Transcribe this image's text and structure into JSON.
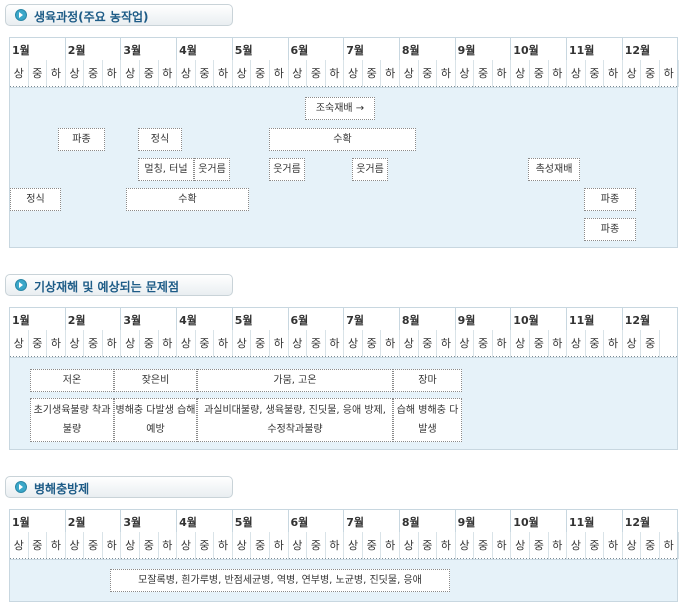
{
  "sections": [
    {
      "title": "생육과정(주요 농작업)",
      "months": [
        "1월",
        "2월",
        "3월",
        "4월",
        "5월",
        "6월",
        "7월",
        "8월",
        "9월",
        "10월",
        "11월",
        "12월"
      ],
      "periods": [
        "상",
        "중",
        "하"
      ],
      "boxes": [
        {
          "name": "box-nursery-transplant",
          "text": "조숙재배 →"
        },
        {
          "name": "box-sowing-1",
          "text": "파종"
        },
        {
          "name": "box-planting-1",
          "text": "정식"
        },
        {
          "name": "box-harvest-1",
          "text": "수확"
        },
        {
          "name": "box-mulch-tunnel",
          "text": "멀칭, 터널"
        },
        {
          "name": "box-topdress-1",
          "text": "웃거름"
        },
        {
          "name": "box-topdress-2",
          "text": "웃거름"
        },
        {
          "name": "box-topdress-3",
          "text": "웃거름"
        },
        {
          "name": "box-forcing-culture",
          "text": "촉성재배"
        },
        {
          "name": "box-planting-2",
          "text": "정식"
        },
        {
          "name": "box-harvest-2",
          "text": "수확"
        },
        {
          "name": "box-sowing-2",
          "text": "파종"
        },
        {
          "name": "box-sowing-3",
          "text": "파종"
        }
      ]
    },
    {
      "title": "기상재해 및 예상되는 문제점",
      "months": [
        "1월",
        "2월",
        "3월",
        "4월",
        "5월",
        "6월",
        "7월",
        "8월",
        "9월",
        "10월",
        "11월",
        "12월"
      ],
      "periods": [
        "상",
        "중",
        "하"
      ],
      "boxes": [
        {
          "name": "box-low-temp",
          "text": "저온"
        },
        {
          "name": "box-frequent-rain",
          "text": "잦은비"
        },
        {
          "name": "box-drought-heat",
          "text": "가뭄, 고온"
        },
        {
          "name": "box-monsoon",
          "text": "장마"
        },
        {
          "name": "box-early-growth",
          "text": "초기생육불량 착과불량"
        },
        {
          "name": "box-pest-humidity",
          "text": "병해충 다발생 습해예방"
        },
        {
          "name": "box-overgrowth",
          "text": "과실비대불량, 생육불량, 진딧물, 응애 방제, 수정착과불량"
        },
        {
          "name": "box-wet-damage",
          "text": "습해 병해충 다발생"
        }
      ]
    },
    {
      "title": "병해충방제",
      "months": [
        "1월",
        "2월",
        "3월",
        "4월",
        "5월",
        "6월",
        "7월",
        "8월",
        "9월",
        "10월",
        "11월",
        "12월"
      ],
      "periods": [
        "상",
        "중",
        "하"
      ],
      "boxes": [
        {
          "name": "box-disease-list",
          "text": "모잘록병, 흰가루병, 반점세균병, 역병, 연부병, 노균병, 진딧물, 응애"
        }
      ]
    }
  ]
}
